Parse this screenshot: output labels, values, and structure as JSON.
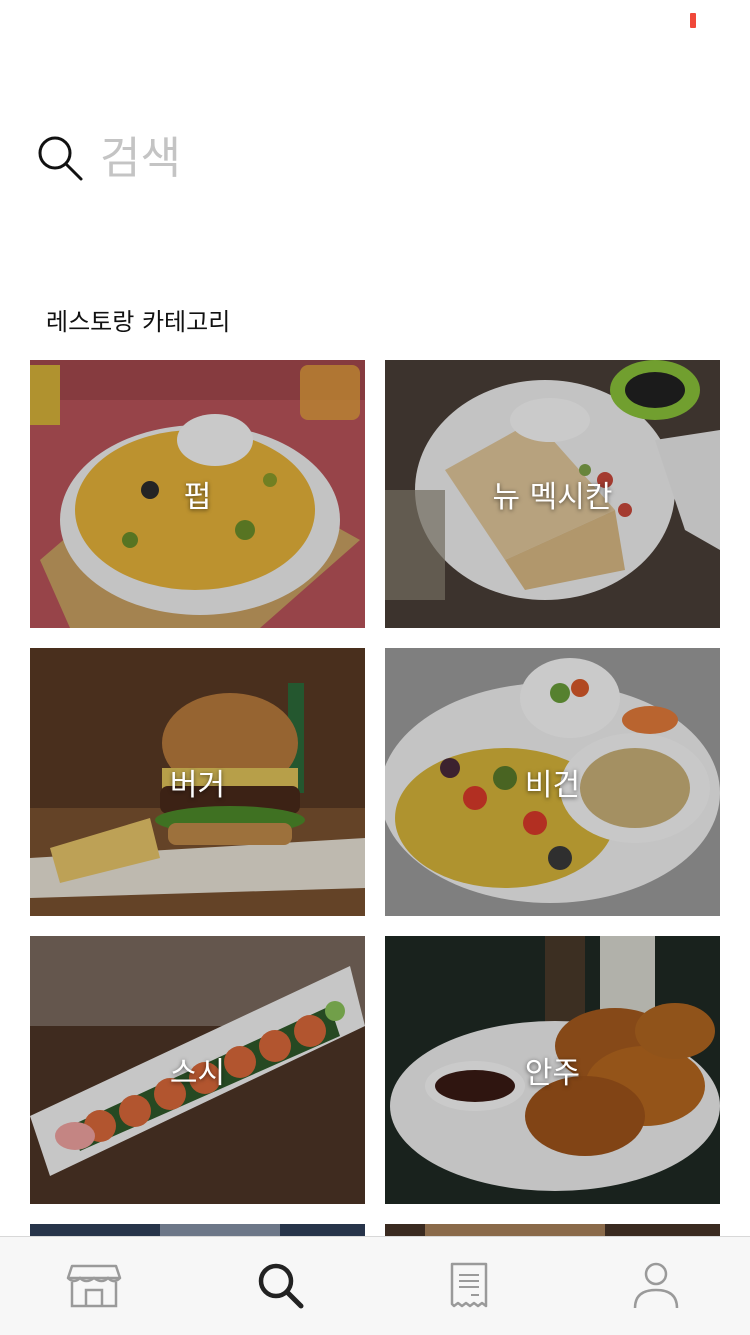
{
  "search": {
    "placeholder": "검색"
  },
  "section": {
    "title": "레스토랑 카테고리"
  },
  "categories": [
    {
      "label": "펍"
    },
    {
      "label": "뉴 멕시칸"
    },
    {
      "label": "버거"
    },
    {
      "label": "비건"
    },
    {
      "label": "스시"
    },
    {
      "label": "안주"
    }
  ],
  "tabbar": {
    "items": [
      {
        "icon": "store-icon",
        "active": false
      },
      {
        "icon": "search-icon",
        "active": true
      },
      {
        "icon": "receipt-icon",
        "active": false
      },
      {
        "icon": "profile-icon",
        "active": false
      }
    ],
    "active_color": "#222222",
    "inactive_color": "#9a9a9a"
  },
  "colors": {
    "status_indicator": "#f0483a"
  }
}
